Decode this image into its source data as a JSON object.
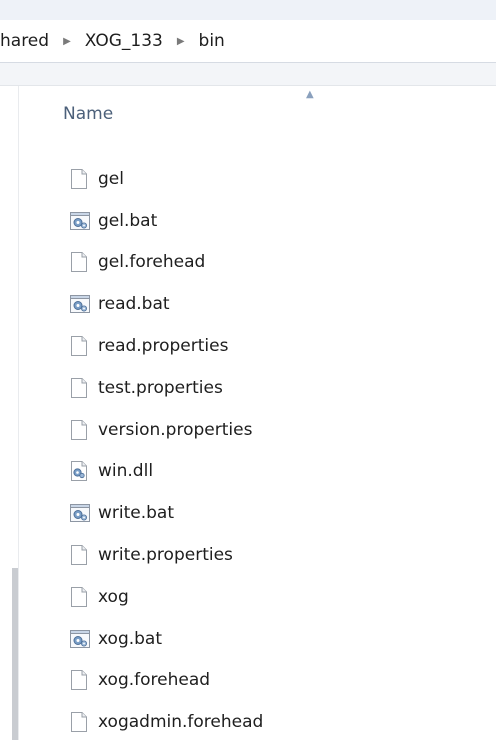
{
  "breadcrumb": {
    "parts": [
      "hared",
      "XOG_133",
      "bin"
    ]
  },
  "columns": {
    "name": "Name"
  },
  "files": [
    {
      "name": "gel",
      "icon": "document-icon"
    },
    {
      "name": "gel.bat",
      "icon": "batch-file-gear-icon"
    },
    {
      "name": "gel.forehead",
      "icon": "document-icon"
    },
    {
      "name": "read.bat",
      "icon": "batch-file-gear-icon"
    },
    {
      "name": "read.properties",
      "icon": "document-icon"
    },
    {
      "name": "test.properties",
      "icon": "document-icon"
    },
    {
      "name": "version.properties",
      "icon": "document-icon"
    },
    {
      "name": "win.dll",
      "icon": "dll-gear-icon"
    },
    {
      "name": "write.bat",
      "icon": "batch-file-gear-icon"
    },
    {
      "name": "write.properties",
      "icon": "document-icon"
    },
    {
      "name": "xog",
      "icon": "document-icon"
    },
    {
      "name": "xog.bat",
      "icon": "batch-file-gear-icon"
    },
    {
      "name": "xog.forehead",
      "icon": "document-icon"
    },
    {
      "name": "xogadmin.forehead",
      "icon": "document-icon"
    }
  ],
  "colors": {
    "header_text": "#4c607a",
    "breadcrumb_separator": "#7a7a7a",
    "gear": "#5d86b5"
  }
}
